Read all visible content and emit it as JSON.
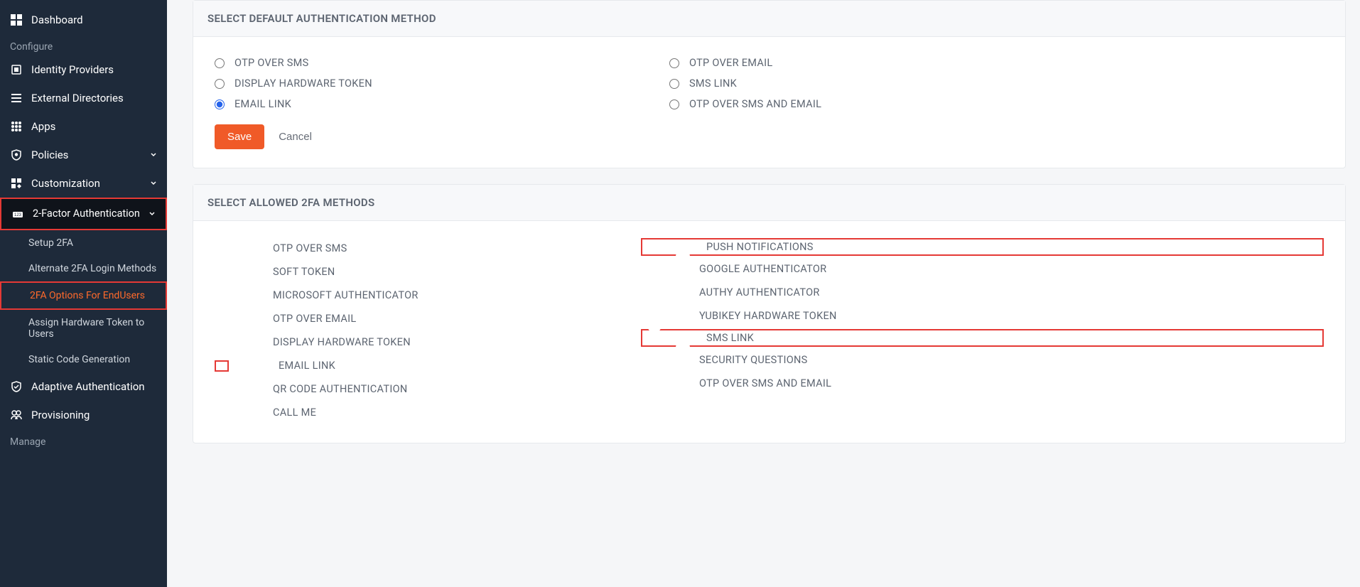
{
  "sidebar": {
    "dashboard": "Dashboard",
    "section_configure": "Configure",
    "identity_providers": "Identity Providers",
    "external_directories": "External Directories",
    "apps": "Apps",
    "policies": "Policies",
    "customization": "Customization",
    "two_factor": "2-Factor Authentication",
    "sub_setup": "Setup 2FA",
    "sub_alt": "Alternate 2FA Login Methods",
    "sub_options": "2FA Options For EndUsers",
    "sub_assign": "Assign Hardware Token to Users",
    "sub_static": "Static Code Generation",
    "adaptive": "Adaptive Authentication",
    "provisioning": "Provisioning",
    "section_manage": "Manage"
  },
  "card1": {
    "title": "SELECT DEFAULT AUTHENTICATION METHOD",
    "left": [
      "OTP OVER SMS",
      "DISPLAY HARDWARE TOKEN",
      "EMAIL LINK"
    ],
    "right": [
      "OTP OVER EMAIL",
      "SMS LINK",
      "OTP OVER SMS AND EMAIL"
    ],
    "save": "Save",
    "cancel": "Cancel"
  },
  "card2": {
    "title": "SELECT ALLOWED 2FA METHODS",
    "left": [
      {
        "label": "OTP OVER SMS",
        "on": false
      },
      {
        "label": "SOFT TOKEN",
        "on": false
      },
      {
        "label": "MICROSOFT AUTHENTICATOR",
        "on": false
      },
      {
        "label": "OTP OVER EMAIL",
        "on": false
      },
      {
        "label": "DISPLAY HARDWARE TOKEN",
        "on": false
      },
      {
        "label": "EMAIL LINK",
        "on": true
      },
      {
        "label": "QR CODE AUTHENTICATION",
        "on": false
      },
      {
        "label": "CALL ME",
        "on": false
      }
    ],
    "right": [
      {
        "label": "PUSH NOTIFICATIONS",
        "on": true
      },
      {
        "label": "GOOGLE AUTHENTICATOR",
        "on": false
      },
      {
        "label": "AUTHY AUTHENTICATOR",
        "on": false
      },
      {
        "label": "YUBIKEY HARDWARE TOKEN",
        "on": false
      },
      {
        "label": "SMS LINK",
        "on": true
      },
      {
        "label": "SECURITY QUESTIONS",
        "on": false
      },
      {
        "label": "OTP OVER SMS AND EMAIL",
        "on": false
      }
    ]
  }
}
